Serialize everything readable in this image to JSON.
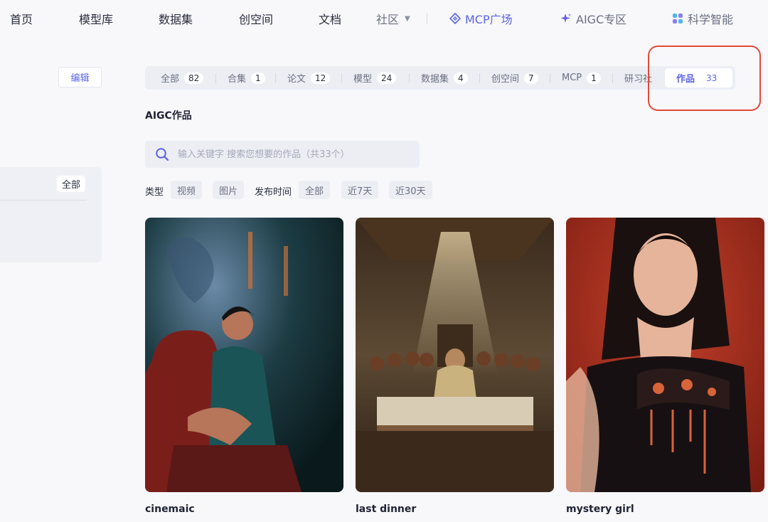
{
  "nav": {
    "items": [
      "首页",
      "模型库",
      "数据集",
      "创空间",
      "文档"
    ],
    "community": "社区",
    "mcp": "MCP广场",
    "aigc": "AIGC专区",
    "science": "科学智能"
  },
  "left": {
    "edit_label": "编辑",
    "all_label": "全部"
  },
  "tabs": [
    {
      "label": "全部",
      "count": "82"
    },
    {
      "label": "合集",
      "count": "1"
    },
    {
      "label": "论文",
      "count": "12"
    },
    {
      "label": "模型",
      "count": "24"
    },
    {
      "label": "数据集",
      "count": "4"
    },
    {
      "label": "创空间",
      "count": "7"
    },
    {
      "label": "MCP",
      "count": "1"
    },
    {
      "label": "研习社",
      "count": ""
    },
    {
      "label": "作品",
      "count": "33"
    }
  ],
  "section_title": "AIGC作品",
  "search": {
    "placeholder": "输入关键字 搜索您想要的作品（共33个）"
  },
  "filters": {
    "type_label": "类型",
    "type_options": [
      "视频",
      "图片"
    ],
    "time_label": "发布时间",
    "time_options": [
      "全部",
      "近7天",
      "近30天"
    ]
  },
  "cards": [
    {
      "title": "cinemaic"
    },
    {
      "title": "last dinner"
    },
    {
      "title": "mystery girl"
    }
  ],
  "colors": {
    "accent": "#5a63e8",
    "annotation": "#e04a3a"
  }
}
